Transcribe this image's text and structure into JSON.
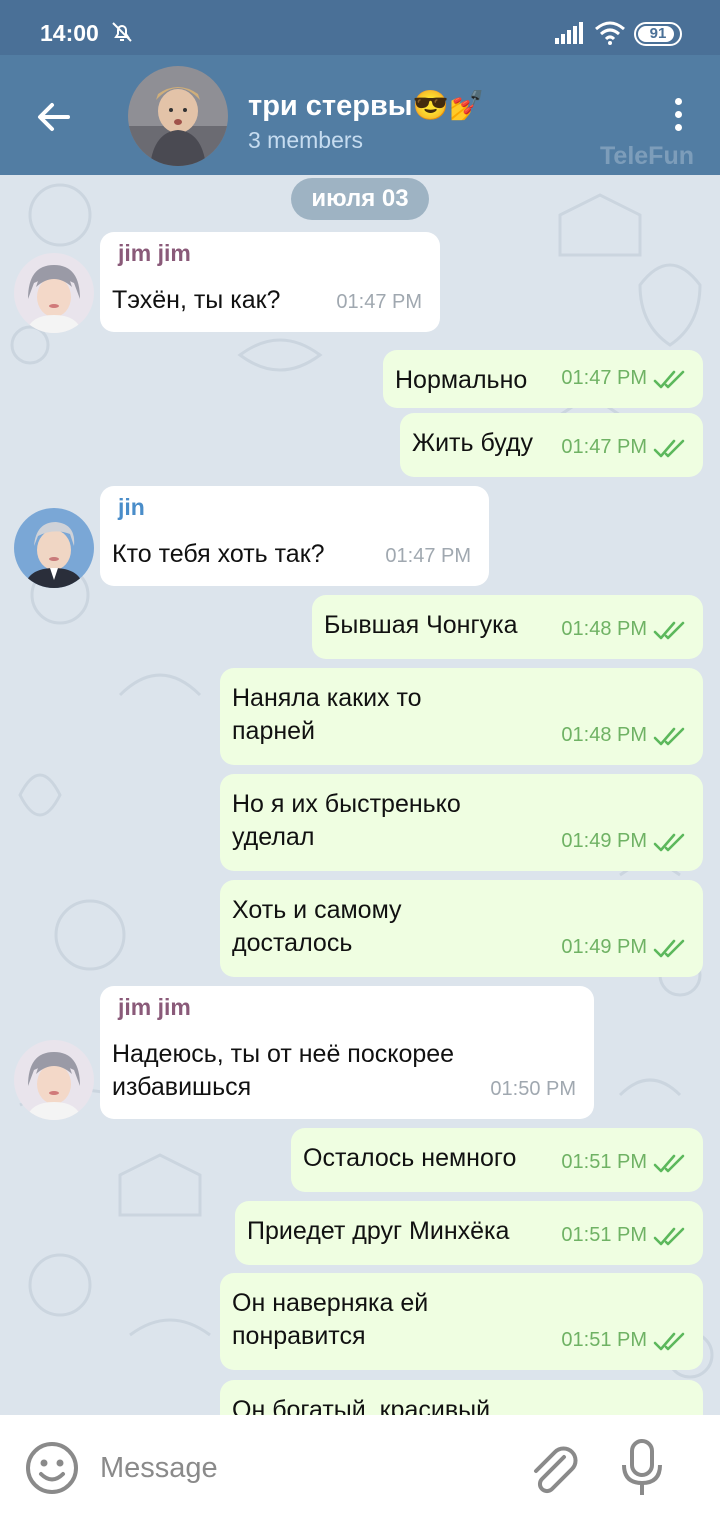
{
  "status_bar": {
    "time": "14:00",
    "battery": "91",
    "battery_level": 0.91
  },
  "header": {
    "title": "три стервы😎💅",
    "subtitle": "3 members",
    "watermark": "TeleFun"
  },
  "chat": {
    "date_label": "июля 03",
    "messages": [
      {
        "dir": "in",
        "sender": "jim jim",
        "text": "Тэхён, ты как?",
        "time": "01:47 PM"
      },
      {
        "dir": "out",
        "text": "Нормально",
        "time": "01:47 PM"
      },
      {
        "dir": "out",
        "text": "Жить буду",
        "time": "01:47 PM"
      },
      {
        "dir": "in",
        "sender": "jin",
        "text": "Кто тебя хоть так?",
        "time": "01:47 PM"
      },
      {
        "dir": "out",
        "text": "Бывшая Чонгука",
        "time": "01:48 PM"
      },
      {
        "dir": "out",
        "text": "Наняла каких то\nпарней",
        "time": "01:48 PM"
      },
      {
        "dir": "out",
        "text": "Но я их быстренько\nуделал",
        "time": "01:49 PM"
      },
      {
        "dir": "out",
        "text": "Хоть и самому\nдосталось",
        "time": "01:49 PM"
      },
      {
        "dir": "in",
        "sender": "jim jim",
        "text": "Надеюсь, ты от неё поскорее\nизбавишься",
        "time": "01:50 PM"
      },
      {
        "dir": "out",
        "text": "Осталось немного",
        "time": "01:51 PM"
      },
      {
        "dir": "out",
        "text": "Приедет друг Минхёка",
        "time": "01:51 PM"
      },
      {
        "dir": "out",
        "text": "Он наверняка ей\nпонравится",
        "time": "01:51 PM"
      },
      {
        "dir": "out",
        "text": "Он богатый, красивый",
        "time": ""
      }
    ]
  },
  "input": {
    "placeholder": "Message"
  },
  "colors": {
    "header": "#527da3",
    "status_bar": "#4a7097",
    "out_bubble": "#effee1",
    "in_bubble": "#ffffff",
    "sender_jim": "#8a5a79",
    "sender_jin": "#4a8dc9",
    "tick": "#5cb85c"
  }
}
